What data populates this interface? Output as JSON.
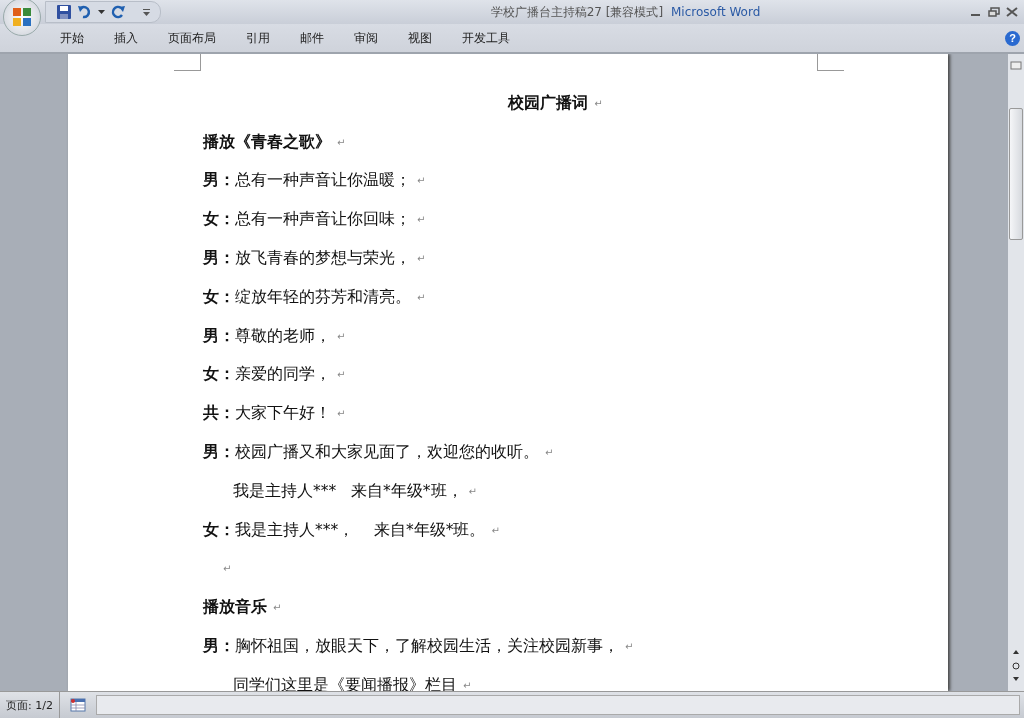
{
  "window": {
    "title": "学校广播台主持稿27 [兼容模式]",
    "app_name": "Microsoft Word"
  },
  "ribbon_tabs": [
    {
      "label": "开始",
      "selected": false
    },
    {
      "label": "插入",
      "selected": false
    },
    {
      "label": "页面布局",
      "selected": false
    },
    {
      "label": "引用",
      "selected": false
    },
    {
      "label": "邮件",
      "selected": false
    },
    {
      "label": "审阅",
      "selected": false
    },
    {
      "label": "视图",
      "selected": false
    },
    {
      "label": "开发工具",
      "selected": false
    }
  ],
  "help_button": "?",
  "document": {
    "paragraphs": [
      {
        "kind": "title",
        "text": "校园广播词",
        "mark": "↵"
      },
      {
        "kind": "heading",
        "text": "播放《青春之歌》",
        "mark": "↵"
      },
      {
        "kind": "line",
        "speaker": "男：",
        "text": "总有一种声音让你温暖；",
        "mark": "↵"
      },
      {
        "kind": "line",
        "speaker": "女：",
        "text": "总有一种声音让你回味；",
        "mark": "↵"
      },
      {
        "kind": "line",
        "speaker": "男：",
        "text": "放飞青春的梦想与荣光，",
        "mark": "↵"
      },
      {
        "kind": "line",
        "speaker": "女：",
        "text": "绽放年轻的芬芳和清亮。",
        "mark": "↵"
      },
      {
        "kind": "line",
        "speaker": "男：",
        "text": "尊敬的老师，",
        "mark": "↵"
      },
      {
        "kind": "line",
        "speaker": "女：",
        "text": "亲爱的同学，",
        "mark": "↵"
      },
      {
        "kind": "line",
        "speaker": "共：",
        "text": "大家下午好！",
        "mark": "↵"
      },
      {
        "kind": "line",
        "speaker": "男：",
        "text": "校园广播又和大家见面了，欢迎您的收听。",
        "mark": "↵"
      },
      {
        "kind": "continuation",
        "text": "我是主持人***   来自*年级*班，",
        "mark": "↵"
      },
      {
        "kind": "line",
        "speaker": "女：",
        "text": "我是主持人***，    来自*年级*班。",
        "mark": "↵"
      },
      {
        "kind": "empty",
        "mark": "↵"
      },
      {
        "kind": "heading",
        "text": "播放音乐",
        "mark": "↵"
      },
      {
        "kind": "line",
        "speaker": "男：",
        "text": "胸怀祖国，放眼天下，了解校园生活，关注校园新事，",
        "mark": "↵"
      },
      {
        "kind": "continuation",
        "text": "同学们这里是《要闻播报》栏目",
        "mark": "↵"
      }
    ]
  },
  "status_bar": {
    "page": "页面: 1/2"
  }
}
